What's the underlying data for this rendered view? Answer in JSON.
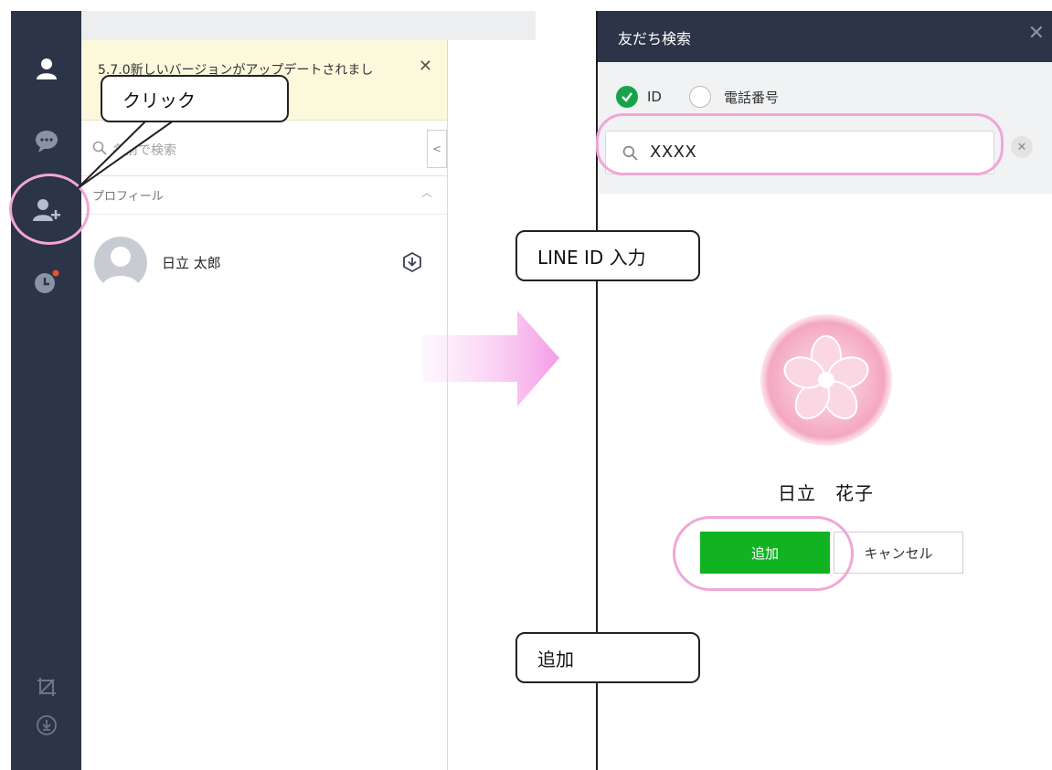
{
  "left_app": {
    "update_notice": "5.7.0新しいバージョンがアップデートされまし",
    "update_close": "✕",
    "search_placeholder": "名前で検索",
    "collapse_arrow": "<",
    "section_label": "プロフィール",
    "section_chevron": "︿",
    "profile_name": "日立 太郎",
    "rail_icons": [
      "person-icon",
      "chat-icon",
      "add-friend-icon",
      "history-icon",
      "crop-icon",
      "download-icon"
    ]
  },
  "annotations": {
    "click_callout": "クリック",
    "lineid_callout": "LINE ID 入力",
    "add_callout": "追加"
  },
  "dialog": {
    "title": "友だち検索",
    "close": "✕",
    "radio_id": "ID",
    "radio_phone": "電話番号",
    "search_value": "XXXX",
    "clear": "✕",
    "result_name": "日立　花子",
    "add_button": "追加",
    "cancel_button": "キャンセル"
  },
  "colors": {
    "rail_bg": "#2c3447",
    "accent_green": "#12b322",
    "highlight_pink": "#f0a6d6",
    "notification_dot": "#e8502e"
  }
}
